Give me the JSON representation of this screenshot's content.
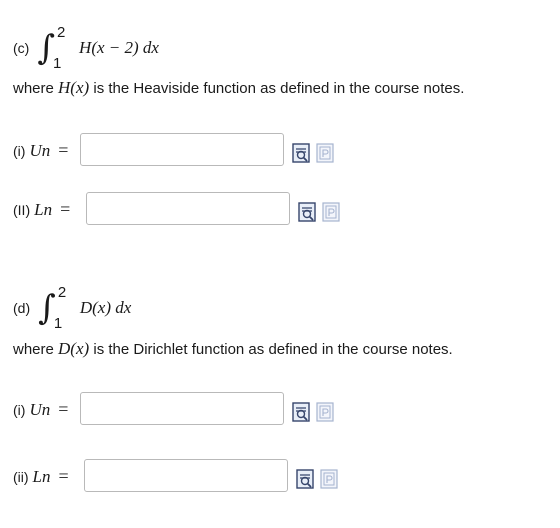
{
  "part_c": {
    "label": "(c)",
    "lower": "1",
    "upper": "2",
    "integrand": "H(x − 2) dx",
    "desc_prefix": "where",
    "desc_math": "H(x)",
    "desc_suffix": "is the Heaviside function as defined in the course notes.",
    "q1_label": "(i)",
    "q1_var": "Un",
    "q2_label": "(II)",
    "q2_var": "Ln",
    "equals": "="
  },
  "part_d": {
    "label": "(d)",
    "lower": "1",
    "upper": "2",
    "integrand": "D(x) dx",
    "desc_prefix": "where",
    "desc_math": "D(x)",
    "desc_suffix": "is the Dirichlet function as defined in the course notes.",
    "q1_label": "(i)",
    "q1_var": "Un",
    "q2_label": "(ii)",
    "q2_var": "Ln",
    "equals": "="
  },
  "inputs": {
    "c1": "",
    "c2": "",
    "d1": "",
    "d2": ""
  },
  "icons": [
    "preview-icon",
    "equation-editor-icon"
  ]
}
